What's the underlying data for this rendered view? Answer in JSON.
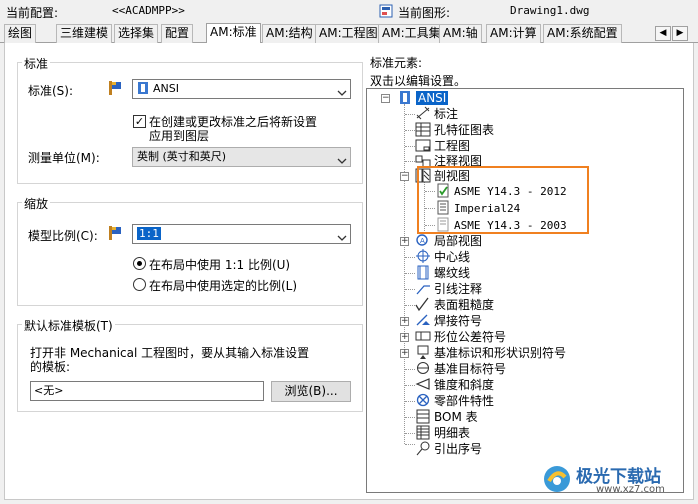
{
  "header": {
    "current_profile_label": "当前配置:",
    "current_profile_value": "<<ACADMPP>>",
    "current_drawing_label": "当前图形:",
    "current_drawing_value": "Drawing1.dwg"
  },
  "tabs": [
    "绘图",
    "三维建模",
    "选择集",
    "配置",
    "AM:标准",
    "AM:结构",
    "AM:工程图",
    "AM:工具集",
    "AM:轴",
    "AM:计算",
    "AM:系统配置"
  ],
  "tab_scroll": {
    "left": "◀",
    "right": "▶"
  },
  "standard_group": {
    "title": "标准",
    "standard_label": "标准(S):",
    "standard_value": "ANSI",
    "checkbox_label_line1": "在创建或更改标准之后将新设置",
    "checkbox_label_line2": "应用到图层",
    "checkbox_checked": "✓",
    "unit_label": "测量单位(M):",
    "unit_value": "英制 (英寸和英尺)"
  },
  "scale_group": {
    "title": "缩放",
    "model_scale_label": "模型比例(C):",
    "model_scale_value": "1:1",
    "radio1_label": "在布局中使用 1:1 比例(U)",
    "radio2_label": "在布局中使用选定的比例(L)"
  },
  "template_group": {
    "title": "默认标准模板(T)",
    "desc_line1": "打开非 Mechanical 工程图时，要从其输入标准设置",
    "desc_line2": "的模板:",
    "template_value": "<无>",
    "browse_button": "浏览(B)..."
  },
  "tree_panel": {
    "title": "标准元素:",
    "subtitle": "双击以编辑设置。",
    "root": "ANSI",
    "items": [
      {
        "label": "标注",
        "icon": "dimension-icon"
      },
      {
        "label": "孔特征图表",
        "icon": "hole-chart-icon"
      },
      {
        "label": "工程图",
        "icon": "drawing-icon"
      },
      {
        "label": "注释视图",
        "icon": "annotation-view-icon"
      },
      {
        "label": "剖视图",
        "icon": "section-view-icon"
      },
      {
        "label": "ASME Y14.3 - 2012",
        "icon": "section-standard-icon"
      },
      {
        "label": "Imperial24",
        "icon": "section-standard-icon"
      },
      {
        "label": "ASME Y14.3 - 2003",
        "icon": "section-standard-icon"
      },
      {
        "label": "局部视图",
        "icon": "detail-view-icon"
      },
      {
        "label": "中心线",
        "icon": "centerline-icon"
      },
      {
        "label": "螺纹线",
        "icon": "thread-icon"
      },
      {
        "label": "引线注释",
        "icon": "leader-note-icon"
      },
      {
        "label": "表面粗糙度",
        "icon": "surface-texture-icon"
      },
      {
        "label": "焊接符号",
        "icon": "weld-symbol-icon"
      },
      {
        "label": "形位公差符号",
        "icon": "fcf-icon"
      },
      {
        "label": "基准标识和形状识别符号",
        "icon": "datum-id-icon"
      },
      {
        "label": "基准目标符号",
        "icon": "datum-target-icon"
      },
      {
        "label": "锥度和斜度",
        "icon": "taper-icon"
      },
      {
        "label": "零部件特性",
        "icon": "part-ref-icon"
      },
      {
        "label": "BOM 表",
        "icon": "bom-icon"
      },
      {
        "label": "明细表",
        "icon": "parts-list-icon"
      },
      {
        "label": "引出序号",
        "icon": "balloon-icon"
      }
    ]
  },
  "expanders": {
    "plus": "+",
    "minus": "−"
  },
  "watermark": {
    "text1": "极光下载站",
    "text2": "www.xz7.com"
  }
}
